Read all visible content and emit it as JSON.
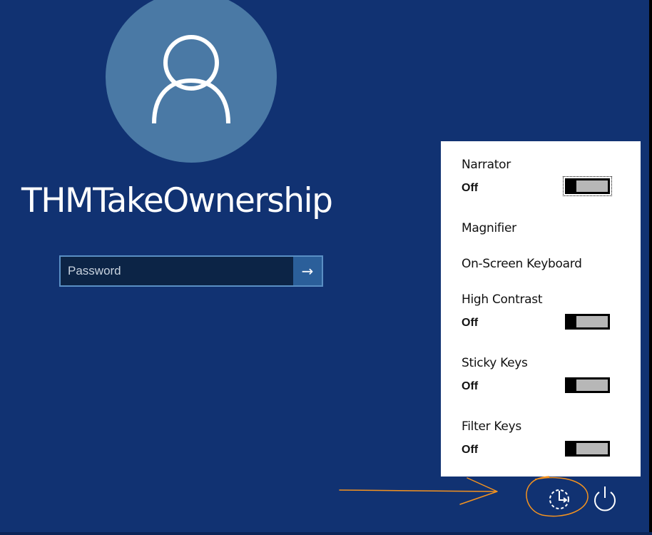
{
  "login": {
    "username": "THMTakeOwnership",
    "password_placeholder": "Password",
    "submit_glyph": "→"
  },
  "ease_of_access": {
    "items": [
      {
        "label": "Narrator",
        "state": "Off",
        "toggle": true,
        "on": false
      },
      {
        "label": "Magnifier",
        "toggle": false
      },
      {
        "label": "On-Screen Keyboard",
        "toggle": false
      },
      {
        "label": "High Contrast",
        "state": "Off",
        "toggle": true,
        "on": false
      },
      {
        "label": "Sticky Keys",
        "state": "Off",
        "toggle": true,
        "on": false
      },
      {
        "label": "Filter Keys",
        "state": "Off",
        "toggle": true,
        "on": false
      }
    ]
  },
  "icons": {
    "avatar": "user-silhouette-icon",
    "ease_of_access": "ease-of-access-icon",
    "power": "power-icon",
    "annotation_arrow": "arrow-icon"
  },
  "colors": {
    "background": "#113272",
    "avatar_circle": "#4a79a5",
    "panel": "#ffffff",
    "toggle_track": "#b7b7b7",
    "annotation": "#f5931f"
  }
}
